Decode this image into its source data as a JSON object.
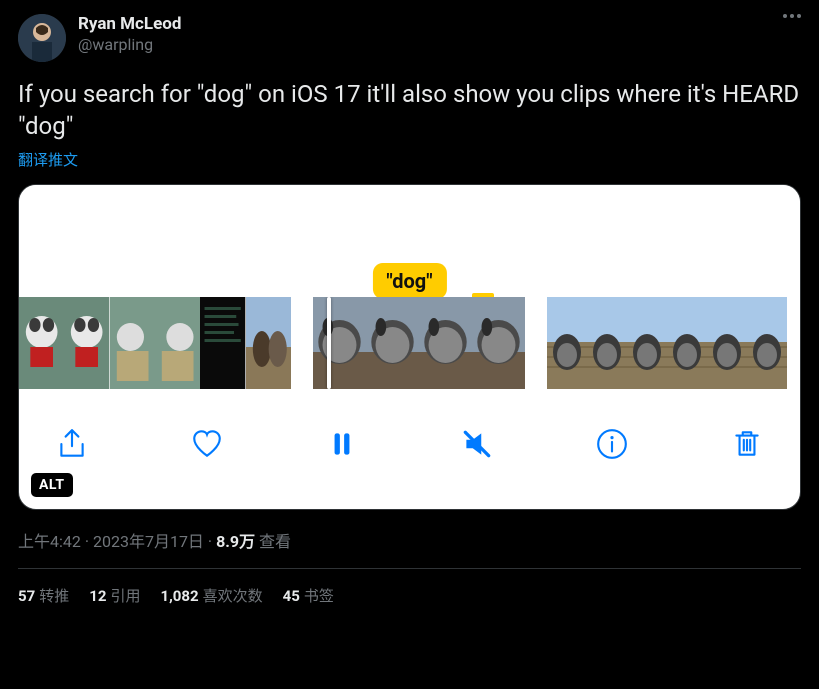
{
  "author": {
    "display_name": "Ryan McLeod",
    "handle": "@warpling"
  },
  "tweet_text": "If you search for \"dog\" on iOS 17 it'll also show you clips where it's HEARD \"dog\"",
  "translate_label": "翻译推文",
  "media": {
    "tooltip_text": "\"dog\"",
    "alt_badge": "ALT",
    "toolbar": {
      "share": "share",
      "like": "like",
      "pause": "pause",
      "mute": "mute",
      "info": "info",
      "trash": "trash"
    }
  },
  "meta": {
    "time": "上午4:42",
    "date": "2023年7月17日",
    "views_count": "8.9万",
    "views_label": "查看"
  },
  "stats": {
    "retweets_count": "57",
    "retweets_label": "转推",
    "quotes_count": "12",
    "quotes_label": "引用",
    "likes_count": "1,082",
    "likes_label": "喜欢次数",
    "bookmarks_count": "45",
    "bookmarks_label": "书签"
  }
}
